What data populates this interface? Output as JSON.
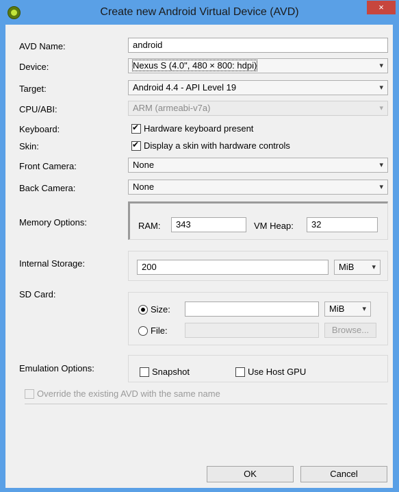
{
  "window": {
    "title": "Create new Android Virtual Device (AVD)",
    "close_glyph": "×",
    "app_icon": "android-eclipse-icon"
  },
  "form": {
    "avd_name_label": "AVD Name:",
    "avd_name_value": "android",
    "device_label": "Device:",
    "device_value": "Nexus S (4.0\", 480 × 800: hdpi)",
    "target_label": "Target:",
    "target_value": "Android 4.4 - API Level 19",
    "cpu_label": "CPU/ABI:",
    "cpu_value": "ARM (armeabi-v7a)",
    "keyboard_label": "Keyboard:",
    "keyboard_checkbox": "Hardware keyboard present",
    "keyboard_checked": true,
    "skin_label": "Skin:",
    "skin_checkbox": "Display a skin with hardware controls",
    "skin_checked": true,
    "front_camera_label": "Front Camera:",
    "front_camera_value": "None",
    "back_camera_label": "Back Camera:",
    "back_camera_value": "None",
    "memory_label": "Memory Options:",
    "ram_label": "RAM:",
    "ram_value": "343",
    "vm_heap_label": "VM Heap:",
    "vm_heap_value": "32",
    "internal_storage_label": "Internal Storage:",
    "internal_storage_value": "200",
    "internal_storage_unit": "MiB",
    "sd_card_label": "SD Card:",
    "sd_size_label": "Size:",
    "sd_size_value": "",
    "sd_size_unit": "MiB",
    "sd_file_label": "File:",
    "sd_file_value": "",
    "browse_label": "Browse...",
    "emulation_label": "Emulation Options:",
    "snapshot_label": "Snapshot",
    "host_gpu_label": "Use Host GPU",
    "override_label": "Override the existing AVD with the same name"
  },
  "buttons": {
    "ok": "OK",
    "cancel": "Cancel"
  },
  "icons": {
    "dropdown": "▾"
  }
}
